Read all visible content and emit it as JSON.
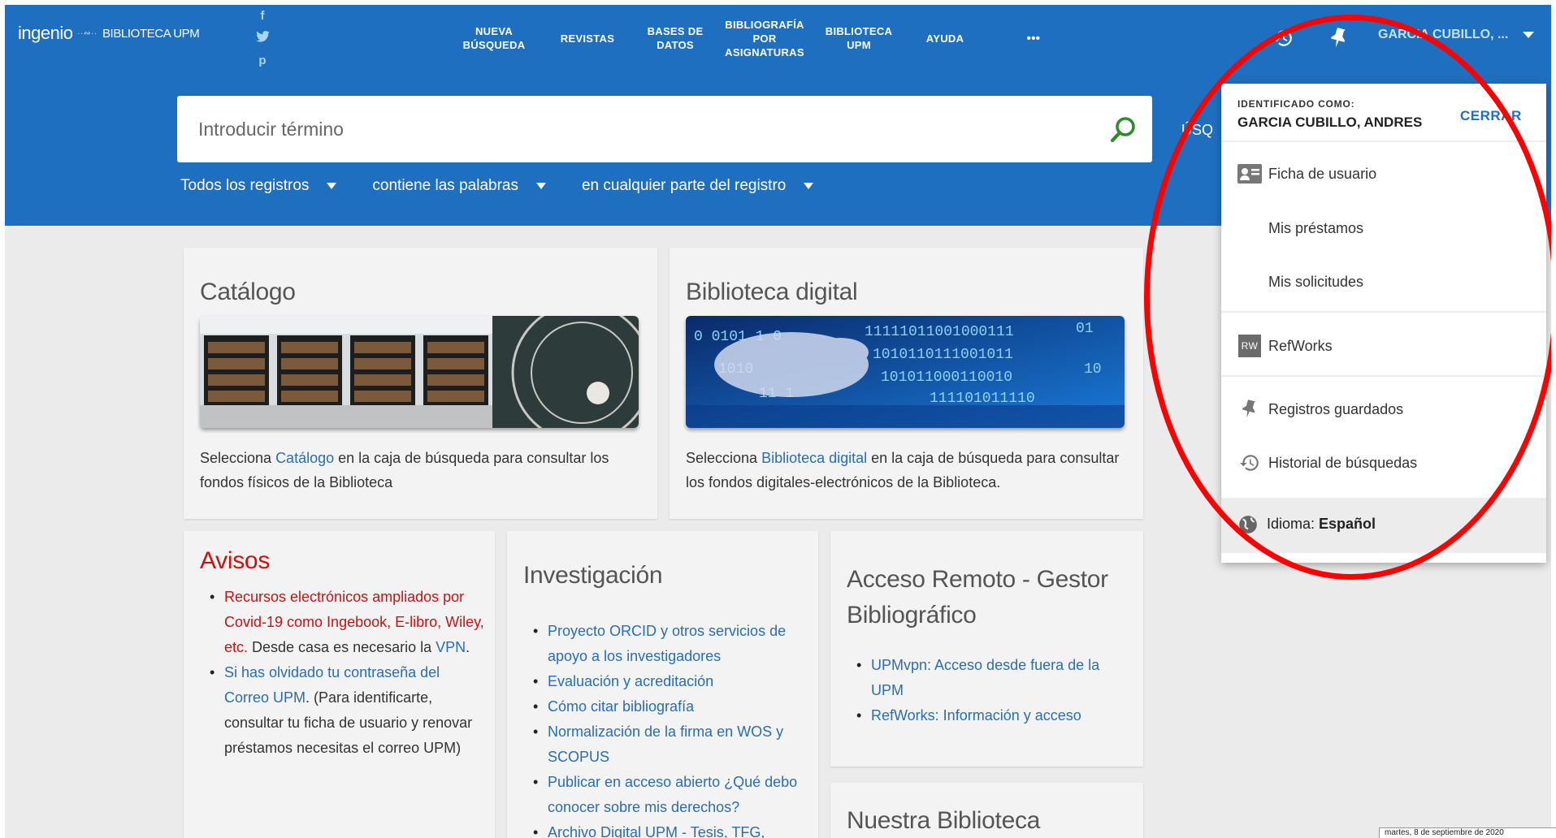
{
  "header": {
    "logo_main": "ingenio",
    "logo_sub": "BIBLIOTECA UPM",
    "social": [
      {
        "icon": "facebook-icon",
        "glyph": "f"
      },
      {
        "icon": "twitter-icon",
        "glyph": "t"
      },
      {
        "icon": "pinterest-icon",
        "glyph": "p"
      }
    ],
    "nav": [
      {
        "line1": "NUEVA",
        "line2": "BÚSQUEDA",
        "line3": ""
      },
      {
        "line1": "REVISTAS",
        "line2": "",
        "line3": ""
      },
      {
        "line1": "BASES DE",
        "line2": "DATOS",
        "line3": ""
      },
      {
        "line1": "BIBLIOGRAFÍA",
        "line2": "POR",
        "line3": "ASIGNATURAS"
      },
      {
        "line1": "BIBLIOTECA",
        "line2": "UPM",
        "line3": ""
      },
      {
        "line1": "AYUDA",
        "line2": "",
        "line3": ""
      },
      {
        "line1": "•••",
        "line2": "",
        "line3": ""
      }
    ],
    "user_label": "GARCIA CUBILLO, ..."
  },
  "search": {
    "placeholder": "Introducir término",
    "advanced_fragment": "ÚSQ",
    "filters": [
      "Todos los registros",
      "contiene las palabras",
      "en cualquier parte del registro"
    ]
  },
  "cards": {
    "catalogo": {
      "title": "Catálogo",
      "text_pre": "Selecciona ",
      "text_link": "Catálogo",
      "text_post": " en la caja de búsqueda para consultar los fondos físicos de la Biblioteca"
    },
    "digital": {
      "title": "Biblioteca digital",
      "text_pre": "Selecciona ",
      "text_link": "Biblioteca digital",
      "text_post": " en la caja de búsqueda para consultar los fondos digitales-electrónicos de la Biblioteca."
    },
    "avisos": {
      "title": "Avisos",
      "item1_link": "Recursos electrónicos ampliados por Covid-19 como Ingebook, E-libro, Wiley, etc.",
      "item1_text": " Desde casa es necesario la ",
      "item1_link2": "VPN",
      "item1_end": ".",
      "item2_link": "Si has olvidado tu contraseña del Correo UPM",
      "item2_text": ". (Para identificarte, consultar tu ficha de usuario y renovar préstamos necesitas el correo UPM)"
    },
    "investigacion": {
      "title": "Investigación",
      "items": [
        "Proyecto ORCID y otros servicios de apoyo a los investigadores",
        "Evaluación y acreditación",
        "Cómo citar bibliografía",
        "Normalización de la firma en WOS y SCOPUS",
        "Publicar en acceso abierto ¿Qué debo conocer sobre mis derechos?",
        "Archivo Digital UPM - Tesis, TFG, TFM,"
      ]
    },
    "acceso": {
      "title_line1": "Acceso Remoto - Gestor",
      "title_line2": "Bibliográfico",
      "items": [
        "UPMvpn: Acceso desde fuera de la UPM",
        "RefWorks: Información y acceso"
      ]
    },
    "nuestra": {
      "title": "Nuestra Biblioteca"
    }
  },
  "dropdown": {
    "identified_as": "IDENTIFICADO COMO:",
    "user_name": "GARCIA CUBILLO, ANDRES",
    "close": "CERRAR",
    "items": [
      "Ficha de usuario",
      "Mis préstamos",
      "Mis solicitudes",
      "RefWorks",
      "Registros guardados",
      "Historial de búsquedas"
    ],
    "refworks_badge": "RW",
    "language_label": "Idioma: ",
    "language_value": "Español"
  },
  "status_tip": "martes, 8 de septiembre de 2020",
  "colors": {
    "header_blue": "#1f6fc1",
    "link_blue": "#2a6db3",
    "alert_red": "#cc1111",
    "annotation_red": "#ff0000",
    "search_icon_green": "#2e8b2e"
  }
}
